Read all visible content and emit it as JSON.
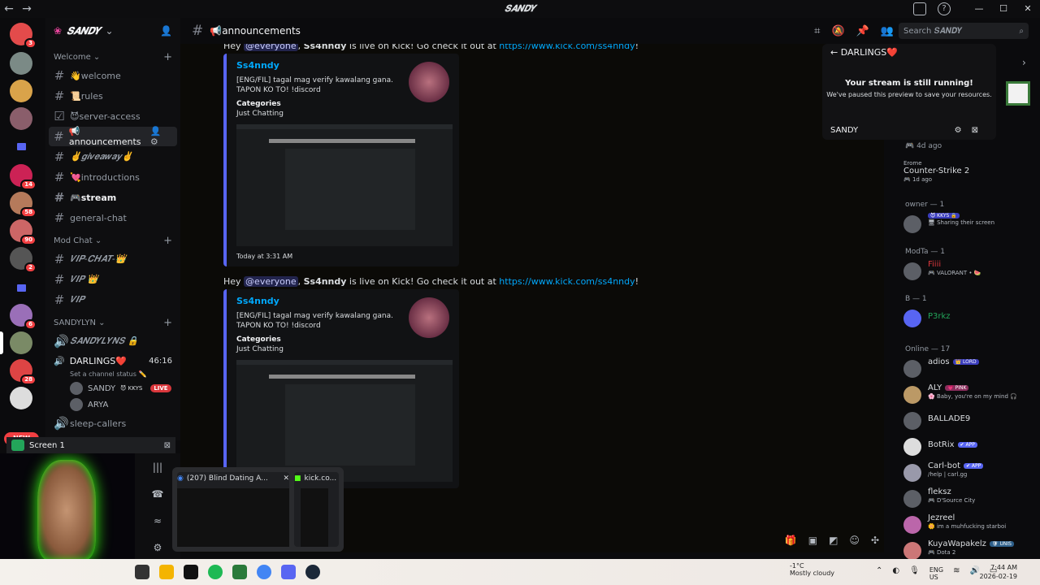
{
  "window": {
    "title": "𝑺𝑨𝑵𝑫𝒀"
  },
  "server": {
    "name": "𝑺𝑨𝑵𝑫𝒀"
  },
  "sidebar": {
    "cat_welcome": "Welcome",
    "ch_welcome": "👋welcome",
    "ch_rules": "📜rules",
    "ch_server_access": "😈server-access",
    "ch_announcements": "📢announcements",
    "ch_giveaway": "✌️𝒈𝒊𝒗𝒆𝒂𝒘𝒂𝒚✌️",
    "ch_introductions": "💘introductions",
    "ch_stream": "🎮stream",
    "ch_general": "general-chat",
    "cat_mod": "Mod Chat",
    "ch_vipchat": "𝑽𝑰𝑷-𝑪𝑯𝑨𝑻-👑",
    "ch_vip": "𝑽𝑰𝑷 👑",
    "ch_vip2": "𝑽𝑰𝑷",
    "cat_sandylyn": "SANDYLYN",
    "ch_sandylyns": "𝑺𝑨𝑵𝑫𝒀𝑳𝒀𝑵𝑺 🔒",
    "voice_darlings": "DARLINGS❤️",
    "voice_time": "46:16",
    "voice_status": "Set a channel status ✏️",
    "vu1": "SANDY",
    "vu1_tag": "😈 KKYS",
    "vu1_live": "LIVE",
    "vu2": "ARYA",
    "ch_sleep": "sleep-callers",
    "new": "NEW"
  },
  "panel": {
    "screen": "Screen 1"
  },
  "chat": {
    "channel": "📢announcements",
    "search_placeholder": "Search 𝑺𝑨𝑵𝑫𝒀",
    "msg1_pre": "Hey ",
    "msg1_mention": "@everyone",
    "msg1_mid1": ", ",
    "msg1_bold": "Ss4nndy",
    "msg1_mid2": " is live on Kick! Go check it out at ",
    "msg1_link": "https://www.kick.com/ss4nndy",
    "msg1_end": "!",
    "embed_author": "Ss4nndy",
    "embed_desc": "[ENG/FIL] tagal mag verify kawalang gana. TAPON KO TO! !discord",
    "embed_field_name": "Categories",
    "embed_field_value": "Just Chatting",
    "embed_foot1": "Today at 3:31 AM"
  },
  "stream_popup": {
    "back": "DARLINGS❤️",
    "title": "Your stream is still running!",
    "subtitle": "We've paused this preview to save your resources.",
    "user": "SANDY"
  },
  "members": {
    "top_st": "🎮 4d ago",
    "erome": "Erome",
    "erome_game": "Counter-Strike 2",
    "erome_st": "🎮 1d ago",
    "owner_hdr": "owner — 1",
    "owner_tag": "😈 KKYS 🔒",
    "owner_st": "🖥 Sharing their screen",
    "modta_hdr": "ModTa — 1",
    "fiji": "Fiiii",
    "fiji_st": "🎮 VALORANT • 🍉",
    "b_hdr": "B — 1",
    "p3rkz": "P3rkz",
    "online_hdr": "Online — 17",
    "m1": "adios",
    "m1_tag": "👑 LORD",
    "m2": "ALY",
    "m2_tag": "💗 PINK",
    "m2_st": "🌸 Baby, you're on my mind 🎧",
    "m3": "BALLADE9",
    "m4": "BotRix",
    "m4_tag": "✔ APP",
    "m5": "Carl-bot",
    "m5_tag": "✔ APP",
    "m5_st": "/help | carl.gg",
    "m6": "fleksz",
    "m6_st": "🎮 D'Source City",
    "m7": "Jezreel",
    "m7_st": "🌼 im a muhfucking starboi",
    "m8": "KuyaWapakelz",
    "m8_tag": "🛡 UNIS",
    "m8_st": "🎮 Dota 2"
  },
  "thumbs": {
    "t1": "(207) Blind Dating A...",
    "t2": "kick.co..."
  },
  "taskbar": {
    "temp": "-1°C",
    "weather": "Mostly cloudy",
    "lang1": "ENG",
    "lang2": "US",
    "time": "7:44 AM",
    "date": "2026-02-19"
  },
  "colors": {
    "accent": "#5865f2",
    "live": "#da373c",
    "online": "#23a55a",
    "link": "#00a8fc"
  }
}
